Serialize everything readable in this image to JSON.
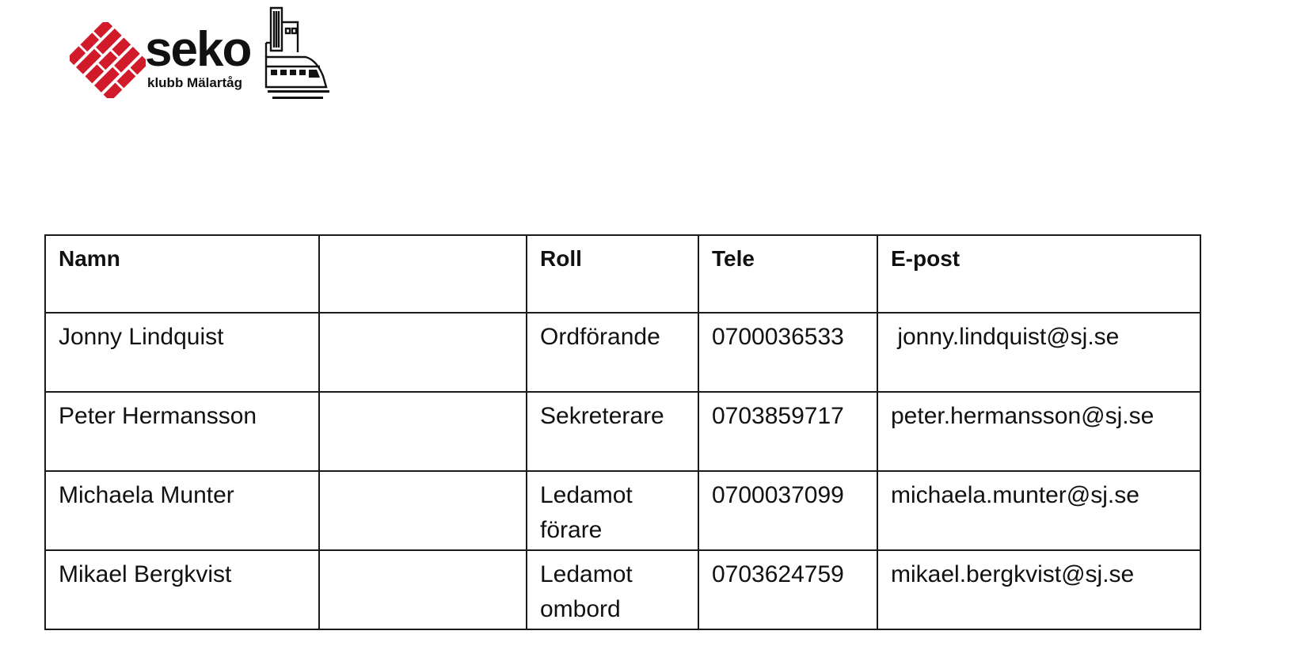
{
  "header": {
    "brand": "seko",
    "subtitle": "klubb Mälartåg",
    "logo_icon": "seko-brick-logo",
    "train_icon": "train-city-icon",
    "brand_color": "#d11a2a"
  },
  "table": {
    "columns": [
      "Namn",
      "",
      "Roll",
      "Tele",
      "E-post"
    ],
    "rows": [
      {
        "name": "Jonny Lindquist",
        "extra": "",
        "role": "Ordförande",
        "phone": "0700036533",
        "email": " jonny.lindquist@sj.se"
      },
      {
        "name": "Peter Hermansson",
        "extra": "",
        "role": "Sekreterare",
        "phone": "0703859717",
        "email": "peter.hermansson@sj.se"
      },
      {
        "name": "Michaela Munter",
        "extra": "",
        "role": "Ledamot förare",
        "phone": "0700037099",
        "email": "michaela.munter@sj.se"
      },
      {
        "name": "Mikael Bergkvist",
        "extra": "",
        "role": "Ledamot ombord",
        "phone": "0703624759",
        "email": "mikael.bergkvist@sj.se"
      }
    ]
  }
}
